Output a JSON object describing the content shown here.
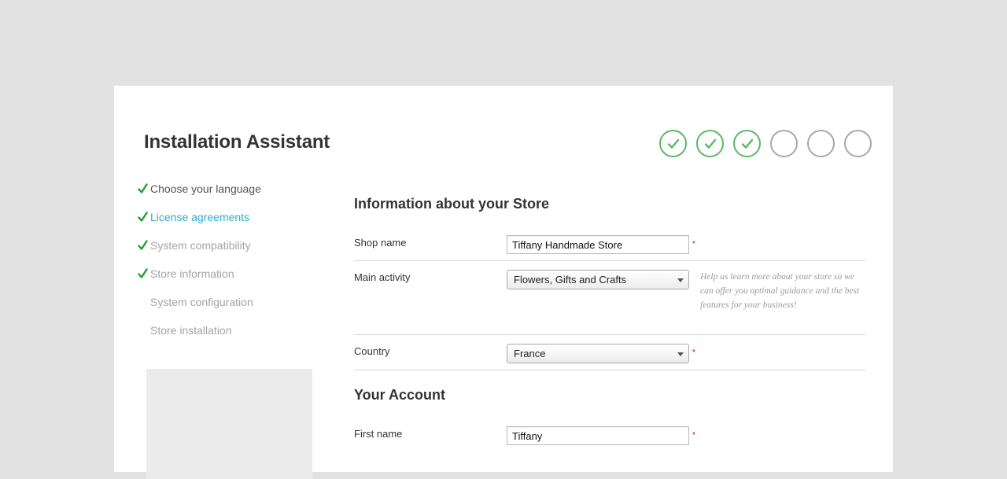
{
  "title": "Installation Assistant",
  "progress": {
    "total_steps": 6,
    "completed_steps": 3
  },
  "colors": {
    "check_green": "#58b862",
    "active_link": "#2eacce",
    "required": "#d0021b"
  },
  "nav": {
    "items": [
      {
        "label": "Choose your language",
        "status": "done"
      },
      {
        "label": "License agreements",
        "status": "done-active"
      },
      {
        "label": "System compatibility",
        "status": "done"
      },
      {
        "label": "Store information",
        "status": "done"
      },
      {
        "label": "System configuration",
        "status": "pending"
      },
      {
        "label": "Store installation",
        "status": "pending"
      }
    ]
  },
  "store_section": {
    "heading": "Information about your Store",
    "shop_name": {
      "label": "Shop name",
      "value": "Tiffany Handmade Store",
      "required": "*"
    },
    "main_activity": {
      "label": "Main activity",
      "value": "Flowers, Gifts and Crafts",
      "help": "Help us learn more about your store so we can offer you optimal guidance and the best features for your business!"
    },
    "country": {
      "label": "Country",
      "value": "France",
      "required": "*"
    }
  },
  "account_section": {
    "heading": "Your Account",
    "first_name": {
      "label": "First name",
      "value": "Tiffany",
      "required": "*"
    }
  },
  "icons": {
    "step_done": "check-circle-icon",
    "step_pending": "empty-circle-icon",
    "nav_done": "checkmark-icon",
    "select": "chevron-down-icon"
  }
}
